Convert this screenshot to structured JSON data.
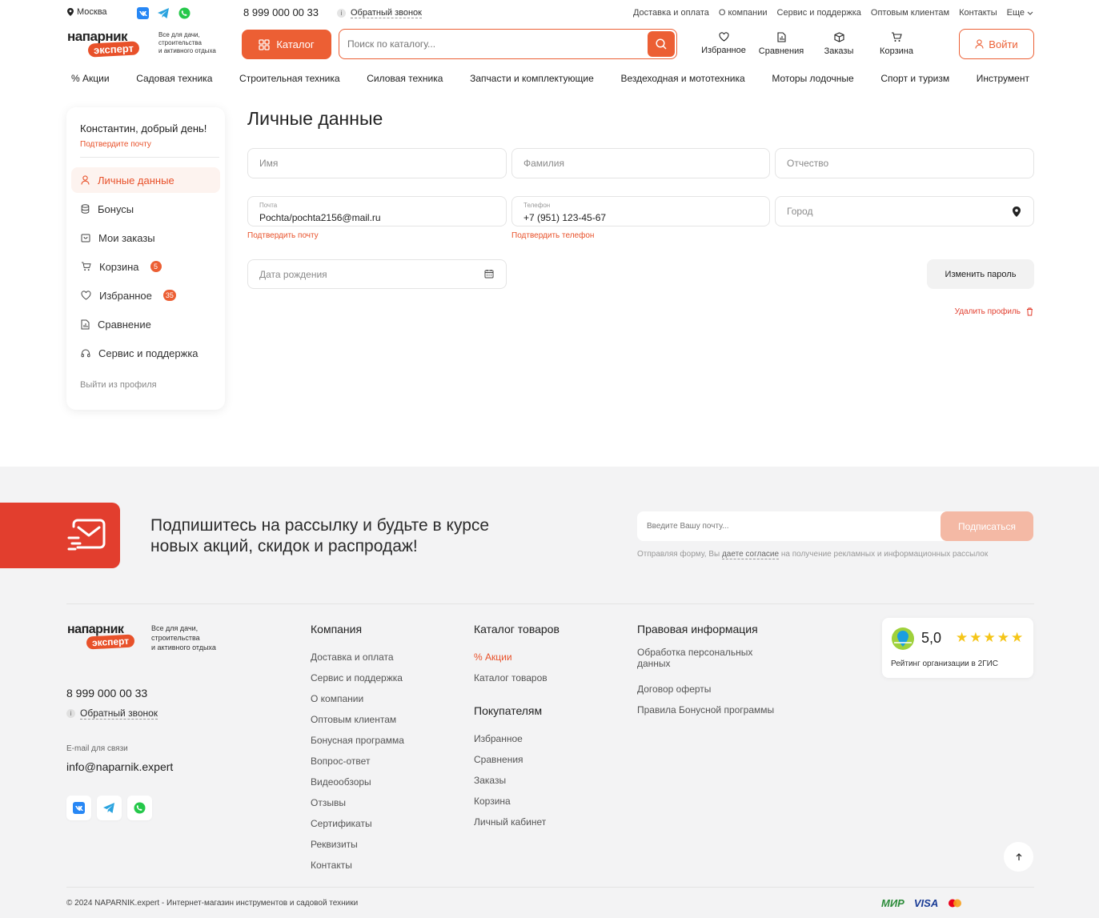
{
  "topbar": {
    "city": "Москва",
    "phone": "8 999 000 00 33",
    "callback": "Обратный звонок",
    "links": [
      "Доставка и оплата",
      "О компании",
      "Сервис и поддержка",
      "Оптовым клиентам",
      "Контакты",
      "Еще"
    ]
  },
  "logo": {
    "line1": "напарник",
    "line2": "эксперт",
    "tagline1": "Все для дачи,",
    "tagline2": "строительства",
    "tagline3": "и активного отдыха"
  },
  "header": {
    "catalog_label": "Каталог",
    "search_placeholder": "Поиск по каталогу...",
    "icons": [
      {
        "label": "Избранное",
        "icon": "heart-icon"
      },
      {
        "label": "Сравнения",
        "icon": "compare-icon"
      },
      {
        "label": "Заказы",
        "icon": "box-icon"
      },
      {
        "label": "Корзина",
        "icon": "cart-icon"
      }
    ],
    "login_label": "Войти"
  },
  "menu": [
    "% Акции",
    "Садовая техника",
    "Строительная техника",
    "Силовая техника",
    "Запчасти и комплектующие",
    "Вездеходная и мототехника",
    "Моторы лодочные",
    "Спорт и туризм",
    "Инструмент"
  ],
  "sidebar": {
    "greeting": "Константин, добрый день!",
    "confirm_email": "Подтвердите почту",
    "items": [
      {
        "label": "Личные данные",
        "icon": "user-icon",
        "active": true
      },
      {
        "label": "Бонусы",
        "icon": "coins-icon"
      },
      {
        "label": "Мои заказы",
        "icon": "orders-icon"
      },
      {
        "label": "Корзина",
        "icon": "cart-icon",
        "badge": "5"
      },
      {
        "label": "Избранное",
        "icon": "heart-icon",
        "badge": "35"
      },
      {
        "label": "Сравнение",
        "icon": "compare-icon"
      },
      {
        "label": "Сервис и поддержка",
        "icon": "headset-icon"
      }
    ],
    "logout": "Выйти из профиля"
  },
  "form": {
    "title": "Личные данные",
    "first_name_placeholder": "Имя",
    "last_name_placeholder": "Фамилия",
    "middle_name_placeholder": "Отчество",
    "email_label": "Почта",
    "email_value": "Pochta/pochta2156@mail.ru",
    "phone_label": "Телефон",
    "phone_value": "+7 (951) 123-45-67",
    "city_placeholder": "Город",
    "confirm_email": "Подтвердить почту",
    "confirm_phone": "Подтвердить телефон",
    "birthdate_placeholder": "Дата рождения",
    "change_password": "Изменить пароль",
    "delete_profile": "Удалить профиль"
  },
  "subscribe": {
    "text1": "Подпишитесь на рассылку и будьте в курсе",
    "text2": "новых акций, скидок и распродаж!",
    "placeholder": "Введите Вашу почту...",
    "button": "Подписаться",
    "note_before": "Отправляя форму, Вы",
    "note_link": "даете согласие",
    "note_after": "на получение рекламных и информационных рассылок"
  },
  "footer": {
    "phone": "8 999 000 00 33",
    "callback": "Обратный звонок",
    "email_label": "E-mail для связи",
    "email": "info@naparnik.expert",
    "company": {
      "title": "Компания",
      "links": [
        "Доставка и оплата",
        "Сервис и поддержка",
        "О компании",
        "Оптовым клиентам",
        "Бонусная программа",
        "Вопрос-ответ",
        "Видеообзоры",
        "Отзывы",
        "Сертификаты",
        "Реквизиты",
        "Контакты"
      ]
    },
    "catalog": {
      "title": "Каталог товаров",
      "links": [
        "% Акции",
        "Каталог товаров"
      ]
    },
    "buyers": {
      "title": "Покупателям",
      "links": [
        "Избранное",
        "Сравнения",
        "Заказы",
        "Корзина",
        "Личный кабинет"
      ]
    },
    "legal": {
      "title": "Правовая информация",
      "links": [
        "Обработка персональных данных",
        "Договор оферты",
        "Правила Бонусной программы"
      ]
    },
    "rating": {
      "value": "5,0",
      "stars": 5,
      "caption": "Рейтинг организации в 2ГИС"
    },
    "copyright": "© 2024 NAPARNIK.expert - Интернет-магазин инструментов и садовой техники",
    "payments": [
      "МИР",
      "VISA",
      "mastercard"
    ]
  },
  "colors": {
    "accent": "#ec5f34",
    "red": "#e23e2e",
    "band": "#f3f3f4",
    "star": "#f5c518"
  }
}
